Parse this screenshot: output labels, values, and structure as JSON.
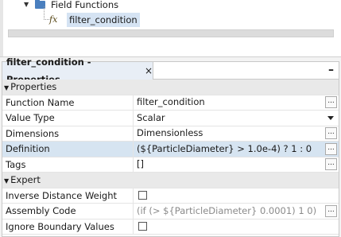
{
  "tree": {
    "folder_label": "Field Functions",
    "item_label": "filter_condition"
  },
  "panel": {
    "tab_title": "filter_condition - Properties",
    "close_glyph": "×",
    "minimize_glyph": "–"
  },
  "sections": {
    "properties": "Properties",
    "expert": "Expert"
  },
  "rows": {
    "function_name": {
      "name": "Function Name",
      "value": "filter_condition"
    },
    "value_type": {
      "name": "Value Type",
      "value": "Scalar"
    },
    "dimensions": {
      "name": "Dimensions",
      "value": "Dimensionless"
    },
    "definition": {
      "name": "Definition",
      "value": "(${ParticleDiameter} > 1.0e-4) ? 1 : 0"
    },
    "tags": {
      "name": "Tags",
      "value": "[]"
    },
    "idw": {
      "name": "Inverse Distance Weight"
    },
    "assembly": {
      "name": "Assembly Code",
      "value": "(if (> ${ParticleDiameter} 0.0001) 1 0)"
    },
    "ignore_boundary": {
      "name": "Ignore Boundary Values"
    }
  },
  "ellipsis_label": "...",
  "icons": {
    "tree_arrow": "down-triangle",
    "folder": "folder-icon",
    "function": "fx-icon",
    "checkbox": "checkbox-empty"
  }
}
